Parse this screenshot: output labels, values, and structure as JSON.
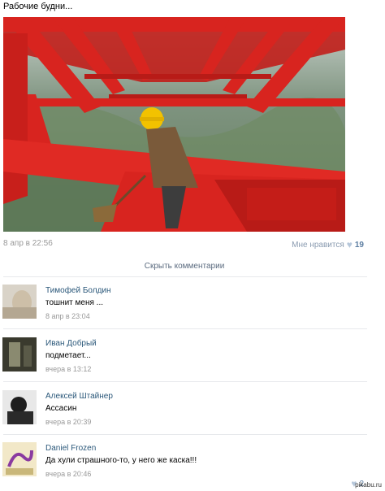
{
  "post": {
    "text": "Рабочие будни...",
    "date": "8 апр в 22:56",
    "like_label": "Мне нравится",
    "like_count": "19"
  },
  "comments_toggle": "Скрыть комментарии",
  "comments": [
    {
      "author": "Тимофей Болдин",
      "text": "тошнит меня ...",
      "date": "8 апр в 23:04"
    },
    {
      "author": "Иван Добрый",
      "text": "подметает...",
      "date": "вчера в 13:12"
    },
    {
      "author": "Алексей Штайнер",
      "text": "Ассасин",
      "date": "вчера в 20:39"
    },
    {
      "author": "Daniel Frozen",
      "text": "Да хули страшного-то, у него же каска!!!",
      "date": "вчера в 20:46",
      "likes": "2"
    }
  ],
  "watermark": "pikabu.ru",
  "colors": {
    "link": "#2b587a",
    "muted": "#999999",
    "girder": "#d8241f"
  }
}
